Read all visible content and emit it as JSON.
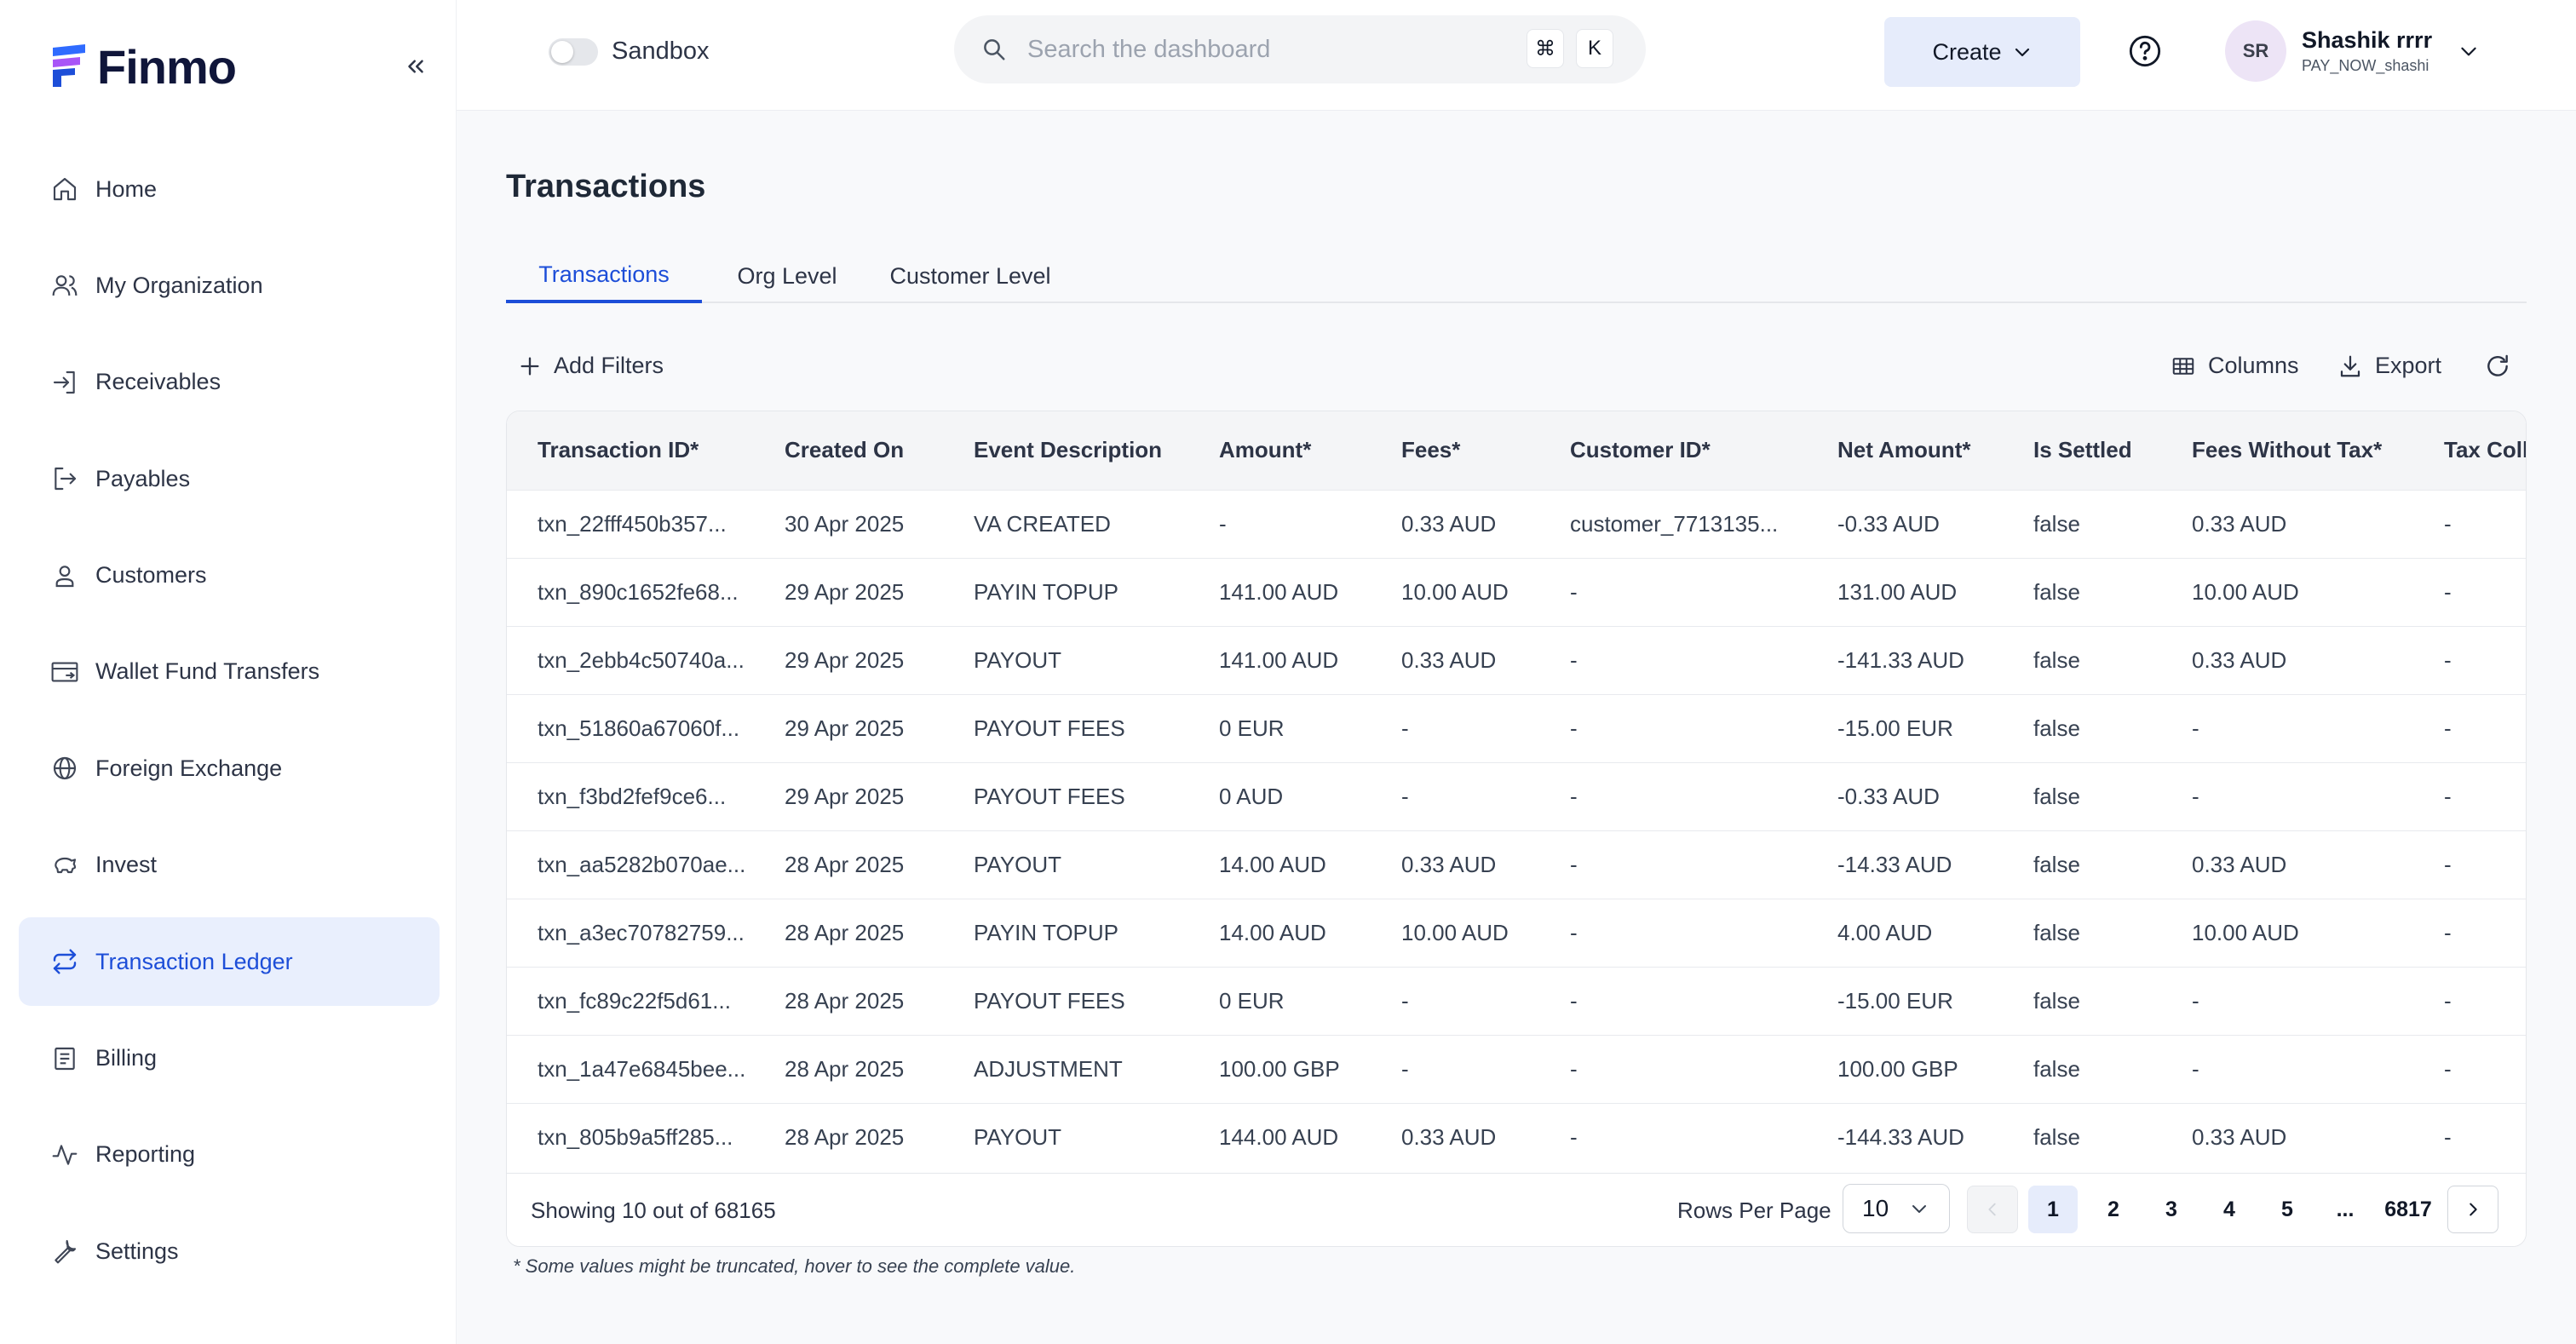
{
  "app": {
    "name": "Finmo"
  },
  "colors": {
    "accent": "#1d4ed8",
    "active_bg": "#e9effd",
    "brand_logo": [
      "#2f6bff",
      "#a855f7",
      "#1d4ed8"
    ]
  },
  "sidebar": {
    "items": [
      {
        "label": "Home",
        "icon": "home-icon"
      },
      {
        "label": "My Organization",
        "icon": "users-icon"
      },
      {
        "label": "Receivables",
        "icon": "login-icon"
      },
      {
        "label": "Payables",
        "icon": "logout-icon"
      },
      {
        "label": "Customers",
        "icon": "user-icon"
      },
      {
        "label": "Wallet Fund Transfers",
        "icon": "wallet-transfer-icon"
      },
      {
        "label": "Foreign Exchange",
        "icon": "globe-icon"
      },
      {
        "label": "Invest",
        "icon": "piggy-bank-icon"
      },
      {
        "label": "Transaction Ledger",
        "icon": "repeat-icon",
        "active": true
      },
      {
        "label": "Billing",
        "icon": "receipt-icon"
      },
      {
        "label": "Reporting",
        "icon": "activity-icon"
      },
      {
        "label": "Settings",
        "icon": "wrench-icon"
      }
    ]
  },
  "header": {
    "sandbox_label": "Sandbox",
    "search_placeholder": "Search the dashboard",
    "shortcut_keys": [
      "⌘",
      "K"
    ],
    "create_label": "Create",
    "user": {
      "initials": "SR",
      "name": "Shashik rrrr",
      "handle": "PAY_NOW_shashi"
    }
  },
  "main": {
    "title": "Transactions",
    "tabs": [
      {
        "label": "Transactions",
        "active": true
      },
      {
        "label": "Org Level"
      },
      {
        "label": "Customer Level"
      }
    ],
    "add_filters_label": "Add Filters",
    "columns_label": "Columns",
    "export_label": "Export"
  },
  "table": {
    "headers": [
      "Transaction ID*",
      "Created On",
      "Event Description",
      "Amount*",
      "Fees*",
      "Customer ID*",
      "Net Amount*",
      "Is Settled",
      "Fees Without Tax*",
      "Tax Collected"
    ],
    "rows": [
      [
        "txn_22fff450b357...",
        "30 Apr 2025",
        "VA CREATED",
        "-",
        "0.33 AUD",
        "customer_7713135...",
        "-0.33 AUD",
        "false",
        "0.33 AUD",
        "-"
      ],
      [
        "txn_890c1652fe68...",
        "29 Apr 2025",
        "PAYIN TOPUP",
        "141.00 AUD",
        "10.00 AUD",
        "-",
        "131.00 AUD",
        "false",
        "10.00 AUD",
        "-"
      ],
      [
        "txn_2ebb4c50740a...",
        "29 Apr 2025",
        "PAYOUT",
        "141.00 AUD",
        "0.33 AUD",
        "-",
        "-141.33 AUD",
        "false",
        "0.33 AUD",
        "-"
      ],
      [
        "txn_51860a67060f...",
        "29 Apr 2025",
        "PAYOUT FEES",
        "0 EUR",
        "-",
        "-",
        "-15.00 EUR",
        "false",
        "-",
        "-"
      ],
      [
        "txn_f3bd2fef9ce6...",
        "29 Apr 2025",
        "PAYOUT FEES",
        "0 AUD",
        "-",
        "-",
        "-0.33 AUD",
        "false",
        "-",
        "-"
      ],
      [
        "txn_aa5282b070ae...",
        "28 Apr 2025",
        "PAYOUT",
        "14.00 AUD",
        "0.33 AUD",
        "-",
        "-14.33 AUD",
        "false",
        "0.33 AUD",
        "-"
      ],
      [
        "txn_a3ec70782759...",
        "28 Apr 2025",
        "PAYIN TOPUP",
        "14.00 AUD",
        "10.00 AUD",
        "-",
        "4.00 AUD",
        "false",
        "10.00 AUD",
        "-"
      ],
      [
        "txn_fc89c22f5d61...",
        "28 Apr 2025",
        "PAYOUT FEES",
        "0 EUR",
        "-",
        "-",
        "-15.00 EUR",
        "false",
        "-",
        "-"
      ],
      [
        "txn_1a47e6845bee...",
        "28 Apr 2025",
        "ADJUSTMENT",
        "100.00 GBP",
        "-",
        "-",
        "100.00 GBP",
        "false",
        "-",
        "-"
      ],
      [
        "txn_805b9a5ff285...",
        "28 Apr 2025",
        "PAYOUT",
        "144.00 AUD",
        "0.33 AUD",
        "-",
        "-144.33 AUD",
        "false",
        "0.33 AUD",
        "-"
      ]
    ]
  },
  "pagination": {
    "showing_text": "Showing 10 out of 68165",
    "rows_per_page_label": "Rows Per Page",
    "rows_per_page_value": "10",
    "pages": [
      "1",
      "2",
      "3",
      "4",
      "5",
      "...",
      "6817"
    ],
    "current_page": "1"
  },
  "footnote": "* Some values might be truncated, hover to see the complete value."
}
